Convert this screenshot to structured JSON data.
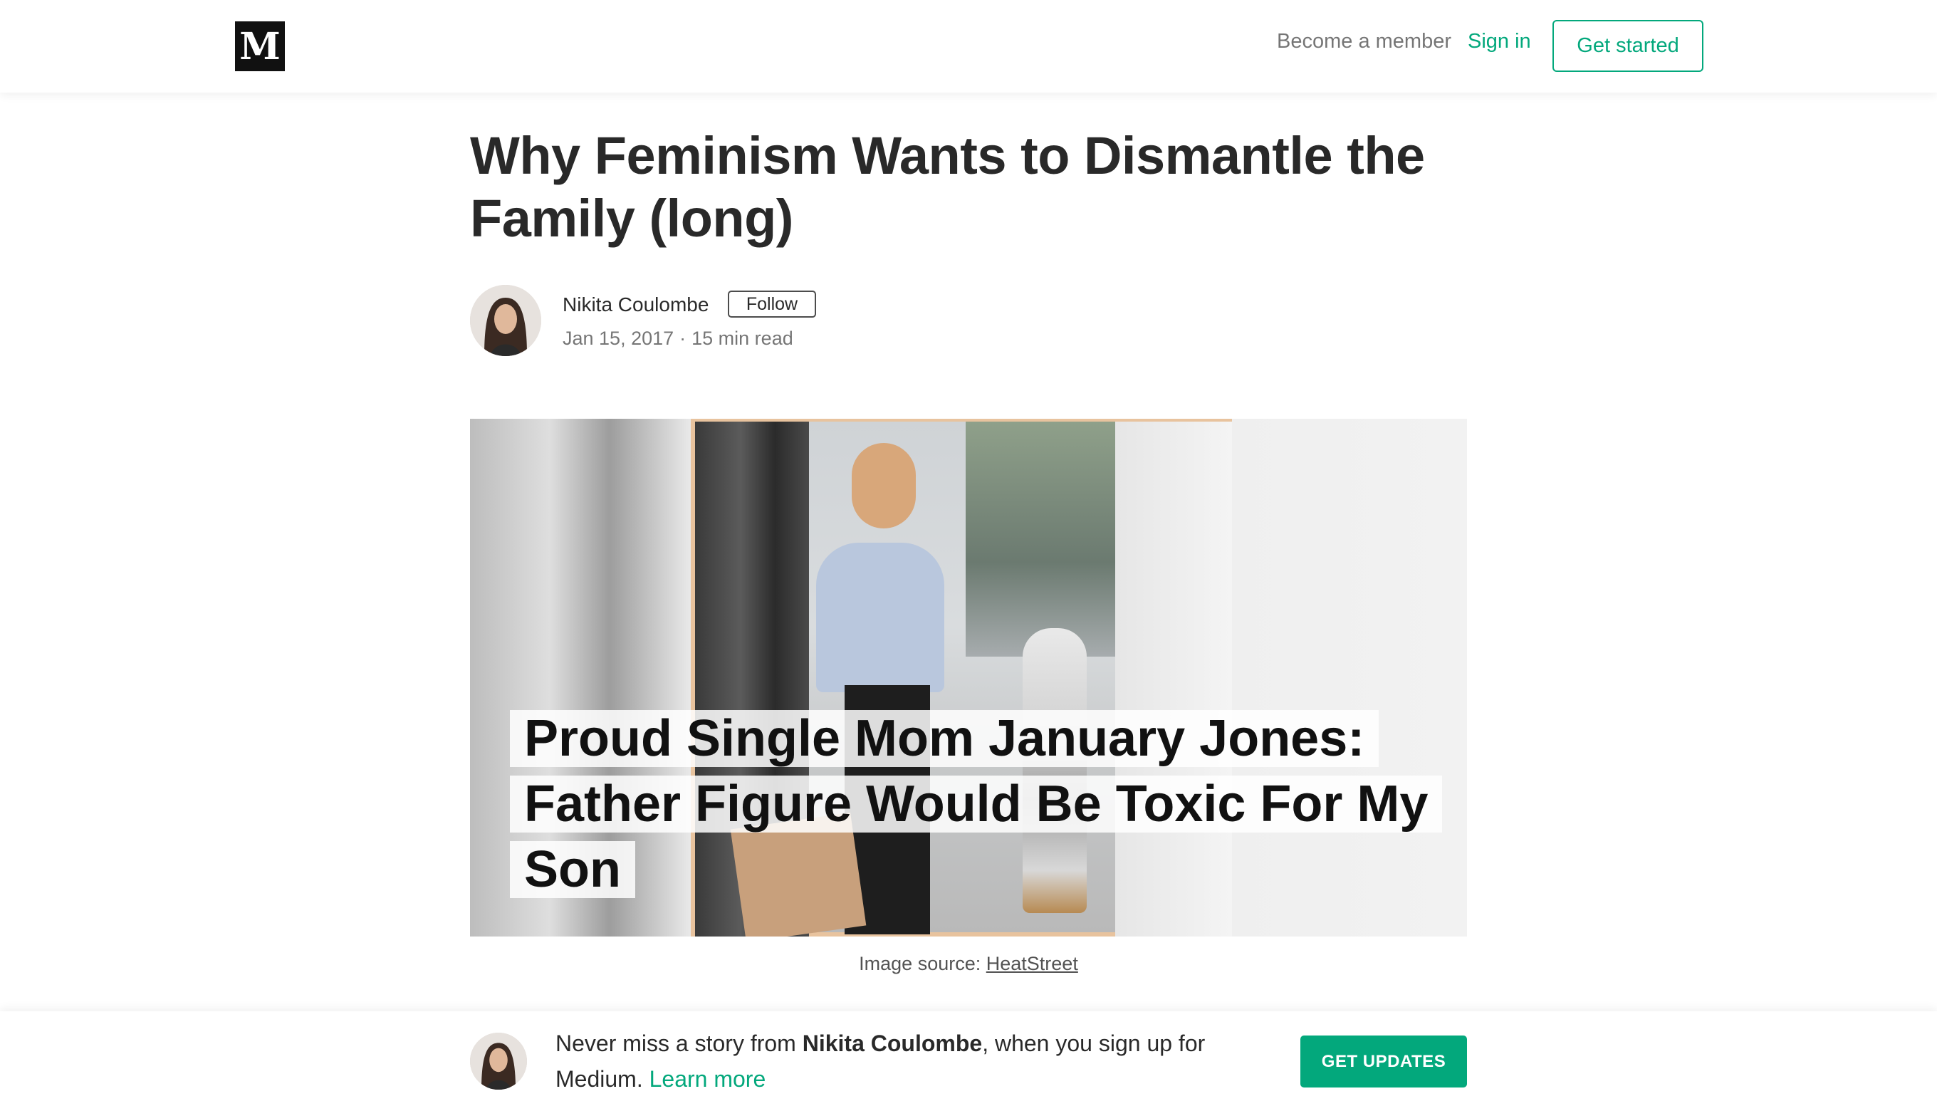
{
  "colors": {
    "accent": "#03a87c",
    "text": "#1a1a1a",
    "muted": "#757575"
  },
  "header": {
    "logo": "M",
    "become_member": "Become a member",
    "sign_in": "Sign in",
    "get_started": "Get started"
  },
  "article": {
    "title": "Why Feminism Wants to Dismantle the Family (long)",
    "author": "Nikita Coulombe",
    "follow": "Follow",
    "date": "Jan 15, 2017",
    "separator": "·",
    "read_time": "15 min read",
    "hero_headline": "Proud Single Mom January Jones: Father Figure Would Be Toxic For My Son",
    "caption_prefix": "Image source: ",
    "caption_link": "HeatStreet"
  },
  "banner": {
    "text_before": "Never miss a story from ",
    "author": "Nikita Coulombe",
    "text_after": ", when you sign up for Medium. ",
    "learn_more": "Learn more",
    "button": "GET UPDATES"
  }
}
